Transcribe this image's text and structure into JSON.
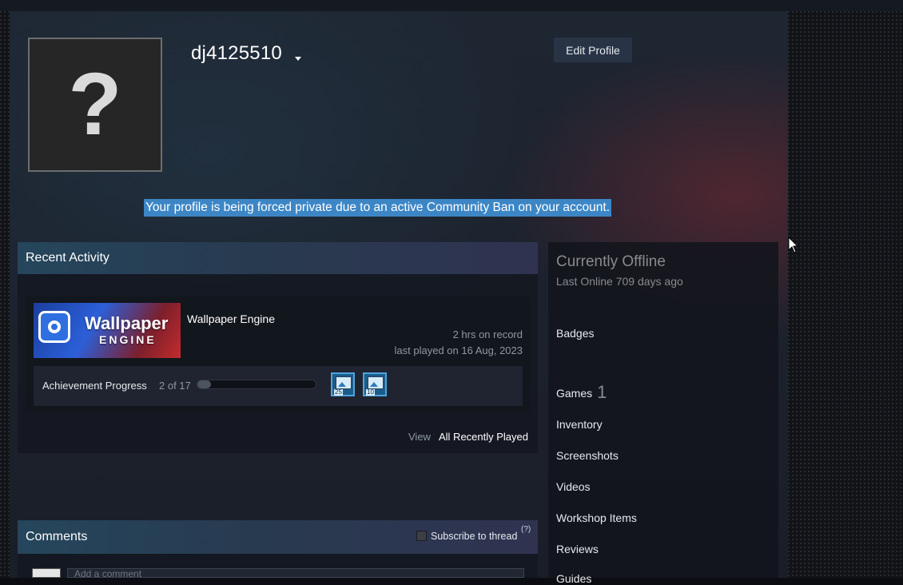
{
  "profile": {
    "persona_name": "dj4125510",
    "avatar_glyph": "?",
    "edit_button": "Edit Profile",
    "ban_message": "Your profile is being forced private due to an active Community Ban on your account."
  },
  "recent_activity": {
    "title": "Recent Activity",
    "game": {
      "name": "Wallpaper Engine",
      "capsule_title": "Wallpaper",
      "capsule_subtitle": "ENGINE",
      "hours": "2 hrs on record",
      "last_played": "last played on 16 Aug, 2023",
      "achievement_label": "Achievement Progress",
      "achievement_count": "2 of 17",
      "achievement_progress_fraction": 0.118,
      "achievement_icons": [
        {
          "icon": "image-icon",
          "badge": "25"
        },
        {
          "icon": "image-icon",
          "badge": "10"
        }
      ]
    },
    "view_label": "View",
    "view_link": "All Recently Played"
  },
  "comments": {
    "title": "Comments",
    "subscribe_label": "Subscribe to thread",
    "help": "(?)",
    "input_placeholder": "Add a comment"
  },
  "sidebar": {
    "status": "Currently Offline",
    "last_online": "Last Online 709 days ago",
    "links": {
      "badges": "Badges",
      "games": "Games",
      "games_count": "1",
      "inventory": "Inventory",
      "screenshots": "Screenshots",
      "videos": "Videos",
      "workshop": "Workshop Items",
      "reviews": "Reviews",
      "guides": "Guides"
    }
  },
  "colors": {
    "highlight": "#3c86c6",
    "header_gradient_start": "#25465c",
    "text_muted": "#898a8c"
  }
}
